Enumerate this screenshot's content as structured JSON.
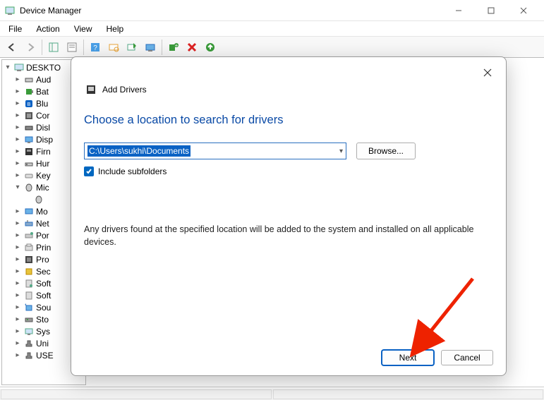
{
  "window": {
    "title": "Device Manager"
  },
  "menu": {
    "file": "File",
    "action": "Action",
    "view": "View",
    "help": "Help"
  },
  "tree": {
    "root": "DESKTO",
    "items": [
      "Aud",
      "Bat",
      "Blu",
      "Cor",
      "Disl",
      "Disp",
      "Firn",
      "Hur",
      "Key",
      "Mic",
      "",
      "Mo",
      "Net",
      "Por",
      "Prin",
      "Pro",
      "Sec",
      "Soft",
      "Soft",
      "Sou",
      "Sto",
      "Sys",
      "Uni",
      "USE"
    ]
  },
  "dialog": {
    "title": "Add Drivers",
    "subtitle": "Choose a location to search for drivers",
    "path_value": "C:\\Users\\sukhi\\Documents",
    "browse_label": "Browse...",
    "include_subfolders_label": "Include subfolders",
    "include_subfolders_checked": true,
    "info_text": "Any drivers found at the specified location will be added to the system and installed on all applicable devices.",
    "next_label": "Next",
    "cancel_label": "Cancel"
  }
}
